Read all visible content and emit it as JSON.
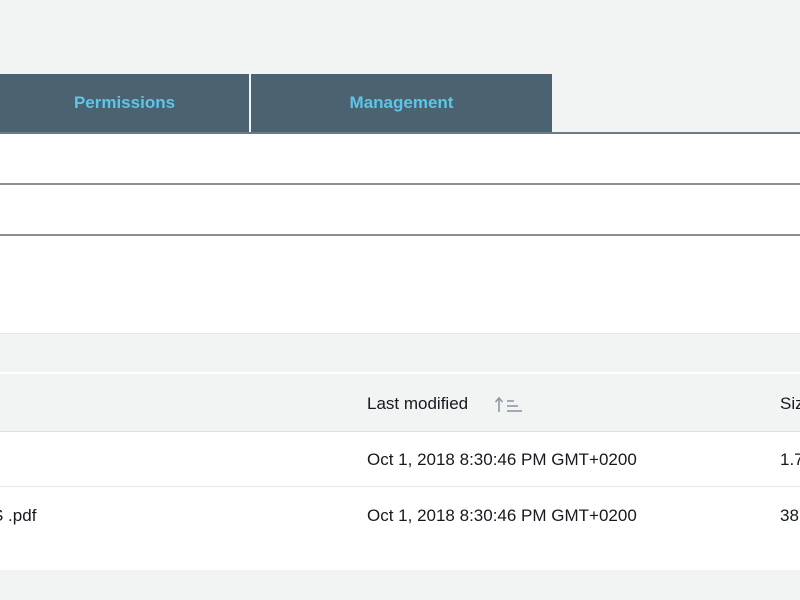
{
  "tabs": [
    {
      "label": "Permissions"
    },
    {
      "label": "Management"
    }
  ],
  "table": {
    "columns": {
      "last_modified": "Last modified",
      "size": "Siz"
    },
    "rows": [
      {
        "name": "",
        "last_modified": "Oct 1, 2018 8:30:46 PM GMT+0200",
        "size": "1.7"
      },
      {
        "name": "S .pdf",
        "last_modified": "Oct 1, 2018 8:30:46 PM GMT+0200",
        "size": "38"
      }
    ]
  },
  "colors": {
    "tab_bg": "#4b6271",
    "tab_text": "#5cc6ea",
    "page_bg": "#f2f3f3"
  },
  "icons": {
    "sort": "sort-ascending-icon"
  }
}
